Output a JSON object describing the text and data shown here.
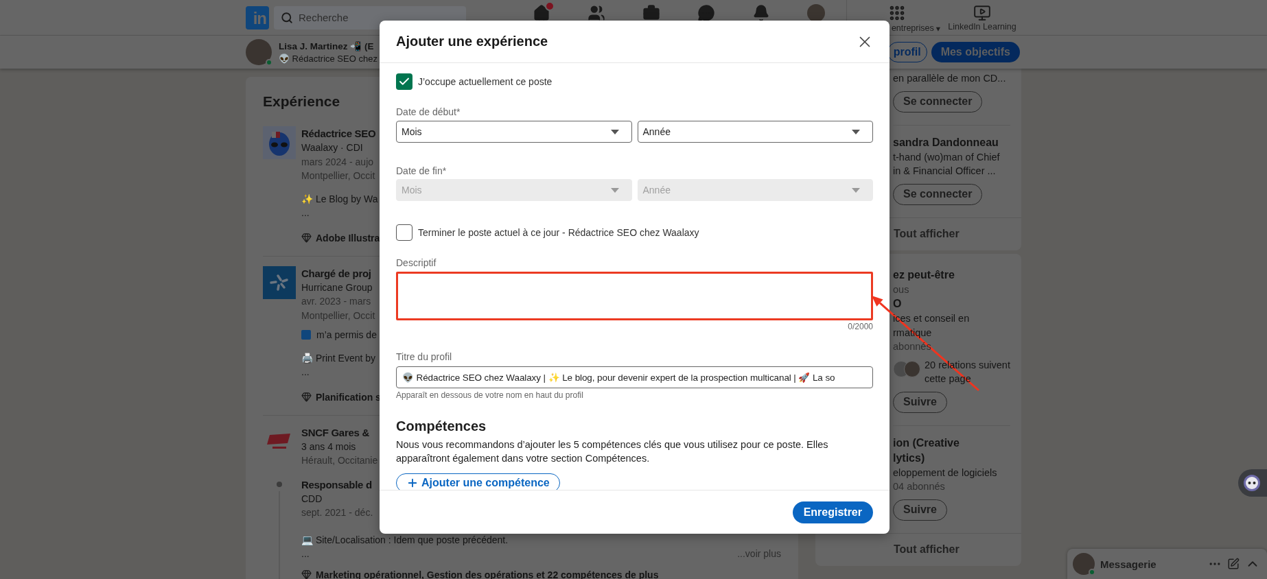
{
  "top_nav": {
    "logo_text": "in",
    "search": {
      "placeholder": "Recherche"
    },
    "nav_icons": [
      {
        "kind": "home",
        "notification": true
      },
      {
        "kind": "network",
        "notification": false
      },
      {
        "kind": "jobs",
        "notification": false
      },
      {
        "kind": "messaging",
        "notification": false
      },
      {
        "kind": "notifications",
        "notification": false
      },
      {
        "kind": "profile",
        "notification": false
      }
    ],
    "business": {
      "label": "entreprises",
      "caret": "▾"
    },
    "learning": {
      "label": "LinkedIn Learning"
    }
  },
  "profile_bar": {
    "name": "Lisa J. Martinez 📲 (E",
    "headline": "👽 Rédactrice SEO chez",
    "buttons": [
      {
        "label": "profil",
        "kind": "outline"
      },
      {
        "label": "Mes objectifs",
        "kind": "primary"
      }
    ]
  },
  "experience": {
    "title": "Expérience",
    "entries": [
      {
        "kind": "alien",
        "title": "Rédactrice SEO",
        "company": "Waalaxy · CDI",
        "dates": "mars 2024 - aujo",
        "location": "Montpellier, Occit",
        "details": [
          {
            "kind": "text",
            "text": "✨ Le Blog by Wa"
          },
          {
            "kind": "cont",
            "text": "..."
          }
        ],
        "skills": "Adobe Illustra"
      },
      {
        "kind": "pinwheel",
        "title": "Chargé de proj",
        "company": "Hurricane Group",
        "dates": "avr. 2023 - mars",
        "location": "Montpellier, Occit",
        "details": [
          {
            "kind": "linked",
            "text": "m’a permis de"
          },
          {
            "kind": "text",
            "text": "🖨️ Print Event by"
          },
          {
            "kind": "cont",
            "text": "..."
          }
        ],
        "skills": "Planification s"
      },
      {
        "kind": "swoosh",
        "title": "SNCF Gares &",
        "company": "3 ans 4 mois",
        "location": "Hérault, Occitanie",
        "roles": [
          {
            "title": "Responsable d",
            "company": "CDD",
            "dates": "sept. 2021 - déc.",
            "details": [
              {
                "kind": "text",
                "text": "💻 Site/Localisation : Idem que poste précédent."
              },
              {
                "kind": "cont",
                "text": "..."
              }
            ],
            "more": "...voir plus",
            "skills": "Marketing opérationnel, Gestion des opérations et 22 compétences de plus"
          }
        ]
      }
    ]
  },
  "sidebar": {
    "cards": [
      {
        "sections": [
          [
            {
              "kind": "text",
              "text": "en parallèle de mon CD..."
            },
            {
              "kind": "button",
              "text": "Se connecter"
            }
          ],
          [
            {
              "kind": "name",
              "text": "sandra Dandonneau"
            },
            {
              "kind": "text",
              "text": "t-hand (wo)man of Chief"
            },
            {
              "kind": "text",
              "text": "in & Financial Officer ..."
            },
            {
              "kind": "button",
              "text": "Se connecter"
            }
          ]
        ],
        "footer": "Tout afficher"
      },
      {
        "sections": [
          [
            {
              "kind": "name",
              "text": "ez peut-être"
            },
            {
              "kind": "muted",
              "text": "ous"
            },
            {
              "kind": "name",
              "text": "O"
            },
            {
              "kind": "text",
              "text": "ices et conseil en"
            },
            {
              "kind": "text",
              "text": "rmatique"
            },
            {
              "kind": "muted",
              "text": "abonnés"
            },
            {
              "kind": "followers",
              "text": "20 relations suivent cette page"
            },
            {
              "kind": "button",
              "text": "Suivre"
            }
          ],
          [
            {
              "kind": "name",
              "text": "ion (Creative"
            },
            {
              "kind": "name",
              "text": "lytics)"
            },
            {
              "kind": "text",
              "text": "eloppement de logiciels"
            },
            {
              "kind": "muted",
              "text": "04 abonnés"
            },
            {
              "kind": "button",
              "text": "Suivre"
            }
          ]
        ],
        "footer": "Tout afficher"
      }
    ]
  },
  "modal": {
    "title": "Ajouter une expérience",
    "current_role": {
      "label": "J’occupe actuellement ce poste",
      "checked": true
    },
    "start_date": {
      "label": "Date de début*",
      "selects": [
        {
          "value": "Mois",
          "disabled": false
        },
        {
          "value": "Année",
          "disabled": false
        }
      ]
    },
    "end_date": {
      "label": "Date de fin*",
      "selects": [
        {
          "value": "Mois",
          "disabled": true
        },
        {
          "value": "Année",
          "disabled": true
        }
      ]
    },
    "end_current": {
      "label": "Terminer le poste actuel à ce jour - Rédactrice SEO chez Waalaxy",
      "checked": false
    },
    "description": {
      "label": "Descriptif",
      "counter": "0/2000",
      "highlighted": true
    },
    "headline": {
      "label": "Titre du profil",
      "value": "👽 Rédactrice SEO chez Waalaxy | ✨ Le blog, pour devenir expert de la prospection multicanal | 🚀 La so",
      "hint": "Apparaît en dessous de votre nom en haut du profil"
    },
    "skills": {
      "title": "Compétences",
      "text": "Nous vous recommandons d’ajouter les 5 compétences clés que vous utilisez pour ce poste. Elles apparaîtront également dans votre section Compétences.",
      "button": "Ajouter une compétence"
    },
    "save_button": "Enregistrer"
  },
  "messaging": {
    "label": "Messagerie"
  }
}
